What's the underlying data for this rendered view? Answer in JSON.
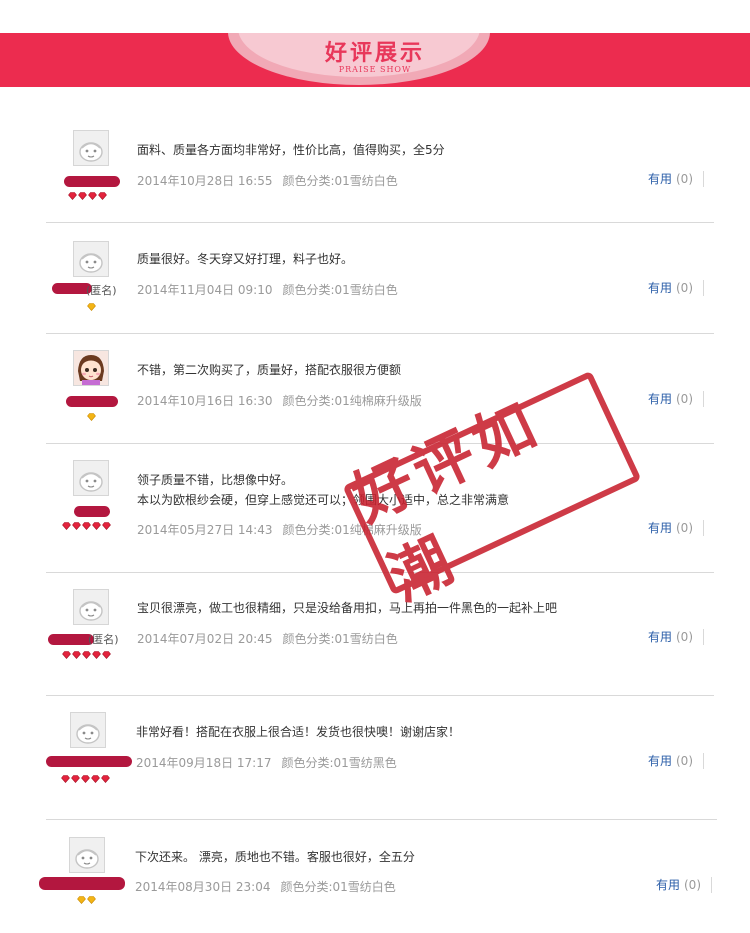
{
  "banner": {
    "title": "好评展示",
    "subtitle": "PRAISE SHOW"
  },
  "stamp_text": "好评如潮",
  "useful_label": "有用",
  "useful_count": "(0)",
  "reviews": [
    {
      "name_tail": "",
      "rank": {
        "count": 4,
        "kind": "red"
      },
      "text": [
        "面料、质量各方面均非常好，性价比高，值得购买，全5分"
      ],
      "date": "2014年10月28日 16:55",
      "sku": "颜色分类:01雪纺白色"
    },
    {
      "name_tail": "(匿名)",
      "rank": {
        "count": 1,
        "kind": "gold"
      },
      "text": [
        "质量很好。冬天穿又好打理，料子也好。"
      ],
      "date": "2014年11月04日 09:10",
      "sku": "颜色分类:01雪纺白色"
    },
    {
      "name_tail": "",
      "rank": {
        "count": 1,
        "kind": "gold"
      },
      "text": [
        "不错，第二次购买了，质量好，搭配衣服很方便额"
      ],
      "date": "2014年10月16日 16:30",
      "sku": "颜色分类:01纯棉麻升级版"
    },
    {
      "name_tail": "",
      "rank": {
        "count": 5,
        "kind": "red"
      },
      "text": [
        "领子质量不错，比想像中好。",
        "本以为欧根纱会硬，但穿上感觉还可以；领围大小适中，总之非常满意"
      ],
      "date": "2014年05月27日 14:43",
      "sku": "颜色分类:01纯棉麻升级版"
    },
    {
      "name_tail": "(匿名)",
      "rank": {
        "count": 5,
        "kind": "red"
      },
      "text": [
        "宝贝很漂亮，做工也很精细，只是没给备用扣，马上再拍一件黑色的一起补上吧"
      ],
      "date": "2014年07月02日 20:45",
      "sku": "颜色分类:01雪纺白色"
    },
    {
      "name_tail": "",
      "rank": {
        "count": 5,
        "kind": "red"
      },
      "text": [
        "非常好看！搭配在衣服上很合适！发货也很快噢！谢谢店家！"
      ],
      "date": "2014年09月18日 17:17",
      "sku": "颜色分类:01雪纺黑色"
    },
    {
      "name_tail": "",
      "rank": {
        "count": 2,
        "kind": "gold"
      },
      "text": [
        "下次还来。 漂亮，质地也不错。客服也很好，全五分"
      ],
      "date": "2014年08月30日 23:04",
      "sku": "颜色分类:01雪纺白色"
    }
  ]
}
